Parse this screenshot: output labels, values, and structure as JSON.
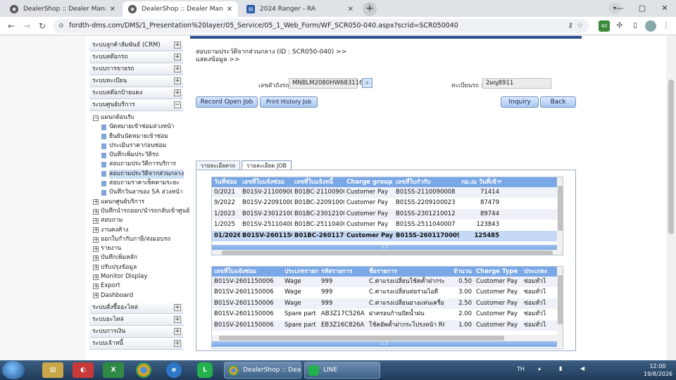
{
  "browser": {
    "tabs": [
      {
        "label": "DealerShop :: Dealer Manageme",
        "active": false
      },
      {
        "label": "DealerShop :: Dealer Manageme",
        "active": true
      },
      {
        "label": "2024 Ranger - RA",
        "active": false
      }
    ],
    "url": "fordth-dms.com/DMS/1_Presentation%20layer/05_Service/05_1_Web_Form/WF_SCR050-040.aspx?scrid=SCR050040",
    "extension_badge": "40"
  },
  "sidebar": {
    "sections_top": [
      {
        "label": "ระบบลูกค้าสัมพันธ์ (CRM)",
        "toggle": "+"
      },
      {
        "label": "ระบบสต๊อกรถ",
        "toggle": "+"
      },
      {
        "label": "ระบบการขายรถ",
        "toggle": "+"
      },
      {
        "label": "ระบบทะเบียน",
        "toggle": "+"
      },
      {
        "label": "ระบบสต๊อกป้ายแดง",
        "toggle": "+"
      },
      {
        "label": "ระบบศูนย์บริการ",
        "toggle": "−"
      }
    ],
    "service_group": {
      "label": "แผนกต้อนรับ",
      "toggle": "−"
    },
    "service_leaves": [
      "นัดหมายเข้าซ่อมล่วงหน้า",
      "ยืนยันนัดหมายเข้าซ่อม",
      "ประเมินราคาก่อนซ่อม",
      "บันทึกเพิ่มประวัติรถ",
      "สอบถามประวัติการบริการ",
      "สอบถามประวัติจากส่วนกลาง",
      "สอบถามราคาเช็คตามระยะ",
      "บันทึกวันลาของ SA ล่วงหน้า"
    ],
    "service_groups_more": [
      "แผนกศูนย์บริการ",
      "บันทึกนำรถออก/นำรถกลับเข้าศูนย์",
      "สอบถาม",
      "งานคงค้าง",
      "ออกใบกำกับภาษี/ส่งมอบรถ",
      "รายงาน",
      "บันทึกเพิ่มหลัก",
      "ปรับปรุงข้อมูล",
      "Monitor Display",
      "Export",
      "Dashboard"
    ],
    "sections_bottom": [
      {
        "label": "ระบบสั่งซื้ออะไหล่",
        "toggle": "+"
      },
      {
        "label": "ระบบอะไหล่",
        "toggle": "+"
      },
      {
        "label": "ระบบการเงิน",
        "toggle": "+"
      },
      {
        "label": "ระบบเจ้าหนี้",
        "toggle": "+"
      }
    ]
  },
  "main": {
    "breadcrumb_line1": "สอบถามประวัติจากส่วนกลาง (ID : SCR050-040) >>",
    "breadcrumb_line2": "แสดงข้อมูล >>",
    "vin_label": "เลขตัวถังรถ :",
    "vin_value": "MNBLM2080HW683116",
    "plate_label": "ทะเบียนรถ :",
    "plate_value": "2ผญ8911",
    "buttons": {
      "record_open_job": "Record Open Job",
      "print_history_job": "Print History Job",
      "inquiry": "Inquiry",
      "back": "Back"
    },
    "tabs": [
      "รายละเอียดรถ",
      "รายละเอียด JOB"
    ],
    "jobs_grid": {
      "columns": [
        "วันที่ซ่อม",
        "เลขที่ใบแจ้งซ่อม",
        "เลขที่ใบแจ้งหนี้",
        "Charge group",
        "เลขที่ใบกำกับ",
        "กม.ณ วันที่เข้าซ่อม"
      ],
      "rows": [
        [
          "0/2021",
          "B01SV-2110090004",
          "B01BC-2110090008",
          "Customer Pay",
          "B01SS-2110090008",
          "71414"
        ],
        [
          "9/2022",
          "B01SV-2209100013",
          "B01BC-2209100021",
          "Customer Pay",
          "B01SS-2209100023",
          "87479"
        ],
        [
          "1/2023",
          "B01SV-2301210017",
          "B01BC-2301210016",
          "Customer Pay",
          "B01SS-2301210012",
          "89744"
        ],
        [
          "1/2025",
          "B01SV-2511040007",
          "B01BC-2511040007",
          "Customer Pay",
          "B01SS-2511040007",
          "123843"
        ],
        [
          "01/2026",
          "B01SV-2601150006",
          "B01BC-2601170019",
          "Customer Pay",
          "B01SS-2601170009",
          "125485"
        ]
      ],
      "pager": "1 2"
    },
    "detail_grid": {
      "columns": [
        "เลขที่ใบแจ้งซ่อม",
        "ประเภทรายการ",
        "รหัสรายการ",
        "ชื่อรายการ",
        "จำนวน",
        "Charge Type",
        "ประเภทง"
      ],
      "rows": [
        [
          "B01SV-2601150006",
          "Wage",
          "999",
          "C.ค่าแรงเปลี่ยนโช้คค้ำฝากระโปรงหน้า",
          "0.50",
          "Customer Pay",
          "ซ่อมทั่วไ"
        ],
        [
          "B01SV-2601150006",
          "Wage",
          "999",
          "C.ค่าแรงเปลี่ยนท่อร่วมไอดี",
          "3.00",
          "Customer Pay",
          "ซ่อมทั่วไ"
        ],
        [
          "B01SV-2601150006",
          "Wage",
          "999",
          "C.ค่าแรงเปลี่ยนยางแท่นเครื่อง",
          "2.50",
          "Customer Pay",
          "ซ่อมทั่วไ"
        ],
        [
          "B01SV-2601150006",
          "Spare part",
          "AB3Z17C526A",
          "ฝาครอบก้านปัดน้ำฝน",
          "2.00",
          "Customer Pay",
          "ซ่อมทั่วไ"
        ],
        [
          "B01SV-2601150006",
          "Spare part",
          "EB3Z16C826A",
          "โช้คอัพค้ำฝากระโปรงหน้า RH",
          "1.00",
          "Customer Pay",
          "ซ่อมทั่วไ"
        ]
      ],
      "pager": "1 2"
    }
  },
  "taskbar": {
    "tasks": [
      {
        "label": "DealerShop :: Deal..."
      },
      {
        "label": "LINE"
      }
    ],
    "lang": "TH",
    "time": "12:00",
    "date": "19/8/2026"
  }
}
